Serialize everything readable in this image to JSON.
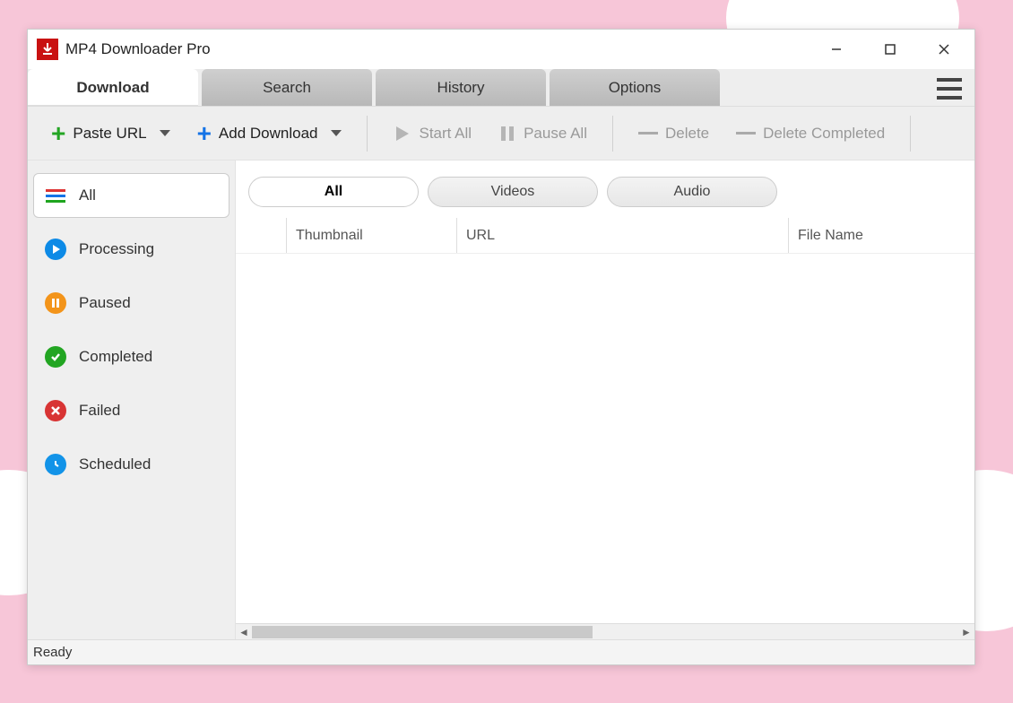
{
  "window": {
    "title": "MP4 Downloader Pro"
  },
  "tabs": [
    {
      "label": "Download",
      "active": true
    },
    {
      "label": "Search",
      "active": false
    },
    {
      "label": "History",
      "active": false
    },
    {
      "label": "Options",
      "active": false
    }
  ],
  "toolbar": {
    "paste_url": "Paste URL",
    "add_download": "Add Download",
    "start_all": "Start All",
    "pause_all": "Pause All",
    "delete": "Delete",
    "delete_completed": "Delete Completed"
  },
  "sidebar": {
    "items": [
      {
        "label": "All",
        "icon": "all",
        "active": true
      },
      {
        "label": "Processing",
        "icon": "processing",
        "active": false
      },
      {
        "label": "Paused",
        "icon": "paused",
        "active": false
      },
      {
        "label": "Completed",
        "icon": "completed",
        "active": false
      },
      {
        "label": "Failed",
        "icon": "failed",
        "active": false
      },
      {
        "label": "Scheduled",
        "icon": "scheduled",
        "active": false
      }
    ]
  },
  "filters": [
    {
      "label": "All",
      "active": true
    },
    {
      "label": "Videos",
      "active": false
    },
    {
      "label": "Audio",
      "active": false
    }
  ],
  "table": {
    "columns": [
      {
        "label": ""
      },
      {
        "label": "Thumbnail"
      },
      {
        "label": "URL"
      },
      {
        "label": "File Name"
      }
    ],
    "rows": []
  },
  "status": "Ready"
}
